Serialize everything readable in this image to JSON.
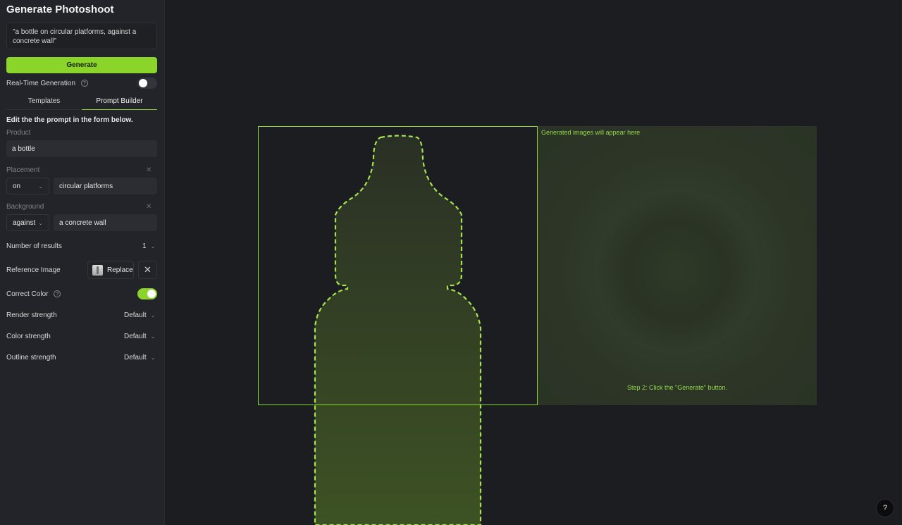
{
  "sidebar": {
    "title": "Generate Photoshoot",
    "prompt_text": "\"a bottle on circular platforms, against a concrete wall\"",
    "generate_label": "Generate",
    "realtime_label": "Real-Time Generation",
    "realtime_enabled": false,
    "tabs": [
      {
        "label": "Templates",
        "active": false
      },
      {
        "label": "Prompt Builder",
        "active": true
      }
    ],
    "hint": "Edit the the prompt in the form below.",
    "product": {
      "label": "Product",
      "value": "a bottle"
    },
    "placement": {
      "label": "Placement",
      "preposition": "on",
      "value": "circular platforms"
    },
    "background": {
      "label": "Background",
      "preposition": "against",
      "value": "a concrete wall"
    },
    "settings": {
      "num_results_label": "Number of results",
      "num_results_value": "1",
      "reference_image_label": "Reference Image",
      "replace_label": "Replace",
      "correct_color_label": "Correct Color",
      "correct_color_enabled": true,
      "render_strength_label": "Render strength",
      "render_strength_value": "Default",
      "color_strength_label": "Color strength",
      "color_strength_value": "Default",
      "outline_strength_label": "Outline strength",
      "outline_strength_value": "Default"
    }
  },
  "canvas": {
    "placeholder_text": "Generated images will appear here",
    "step_text": "Step 2: Click the \"Generate\" button.",
    "accent_color": "#8bd52a"
  },
  "help_button_label": "?"
}
